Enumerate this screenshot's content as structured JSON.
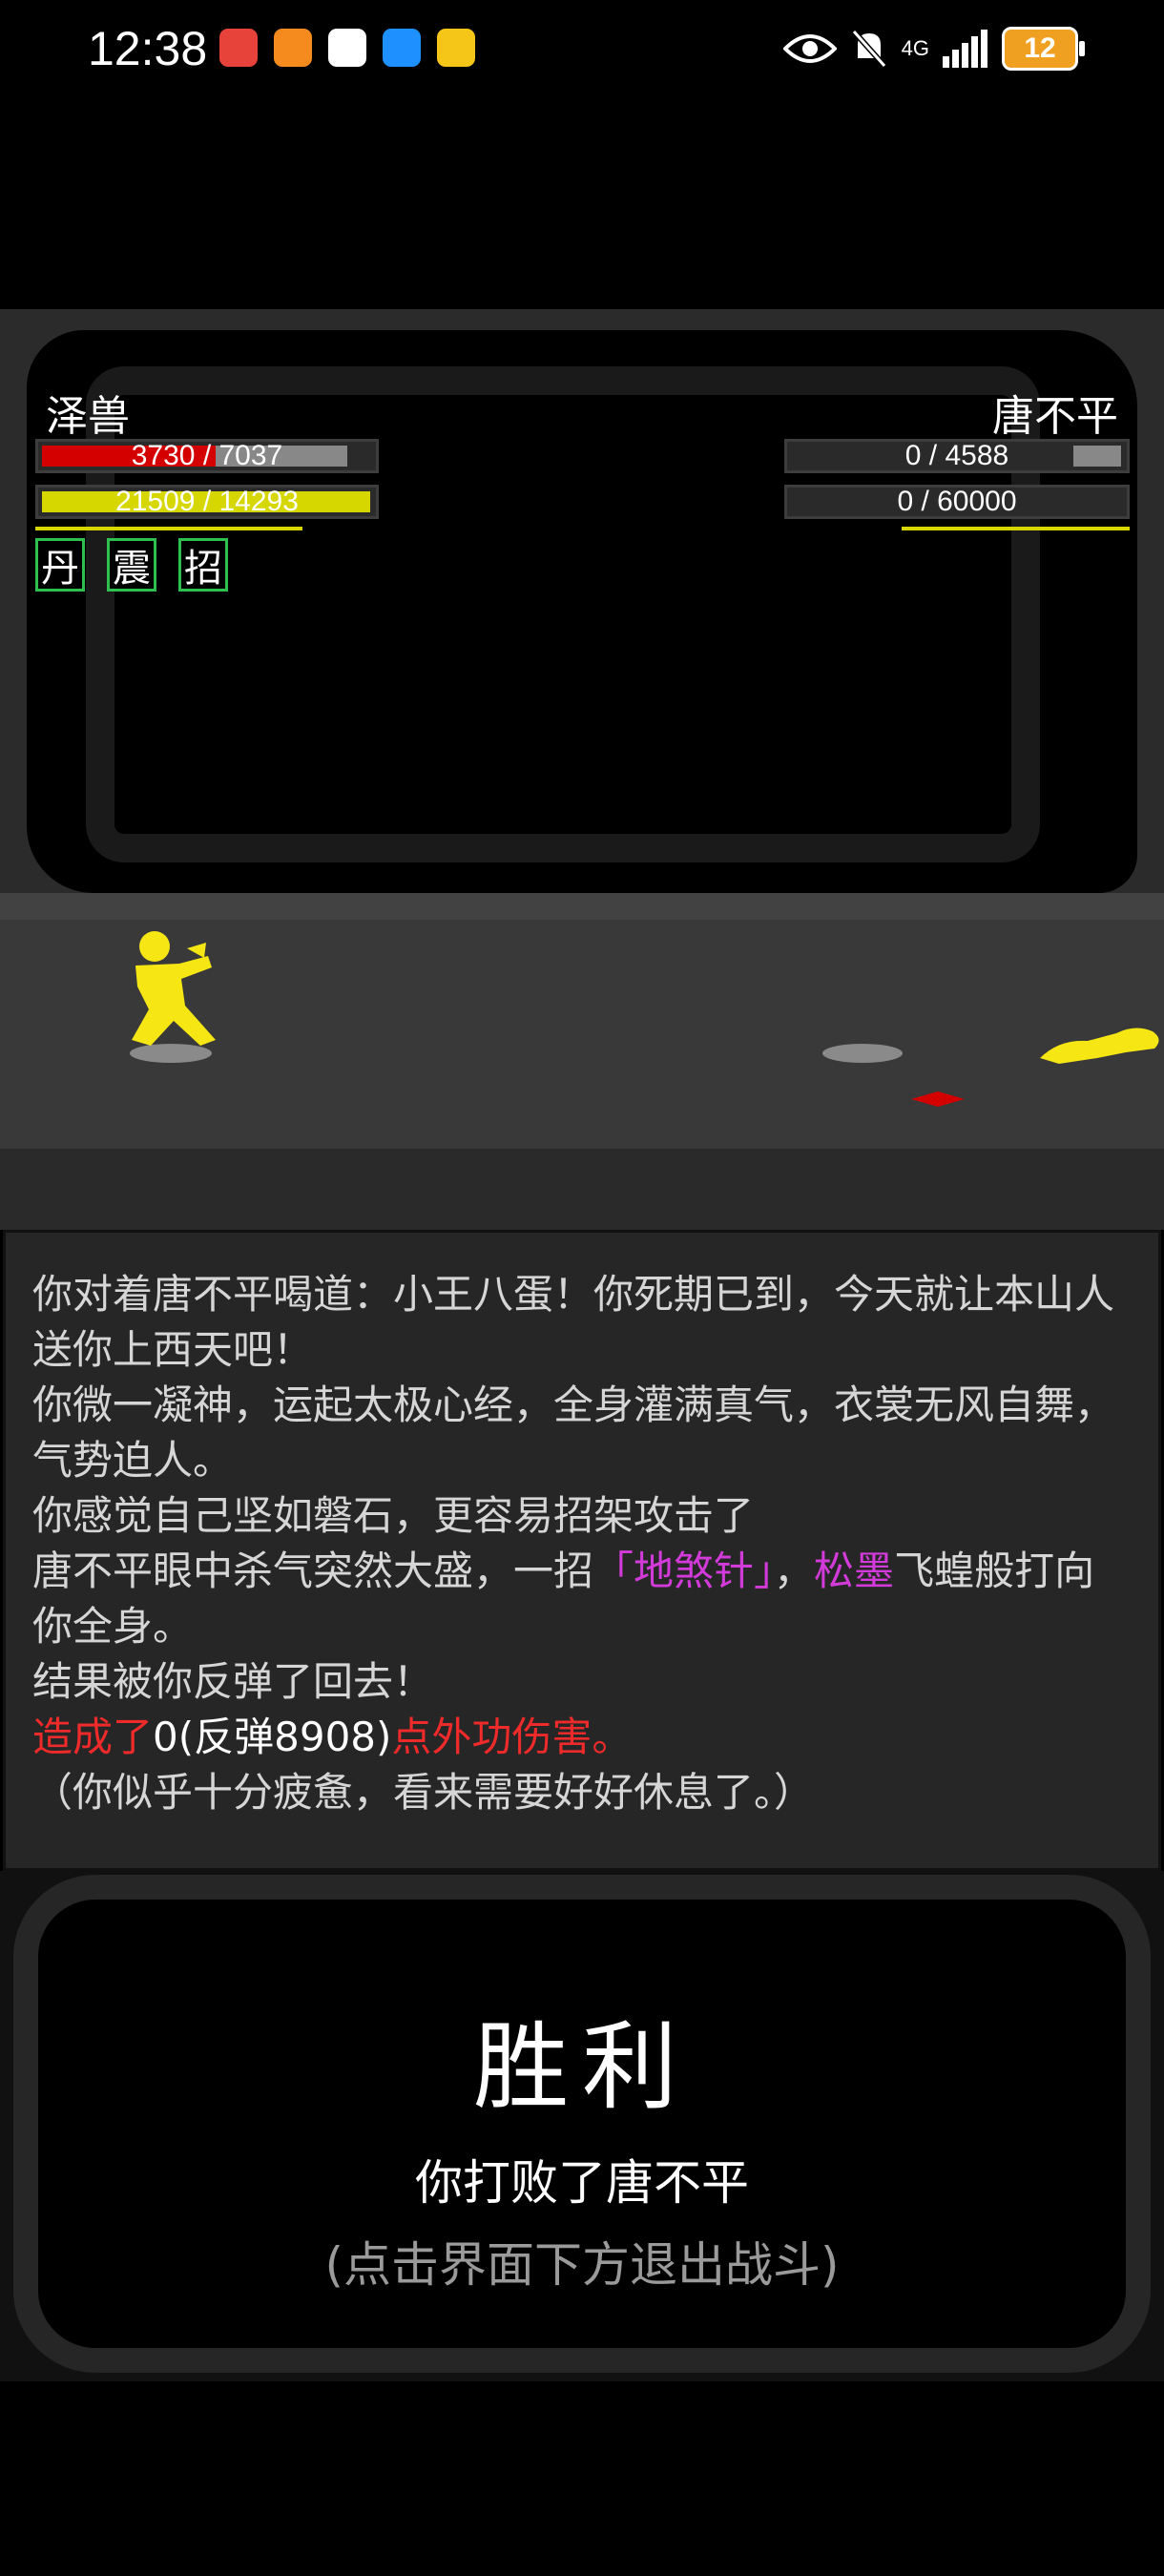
{
  "status_bar": {
    "time": "12:38",
    "network": "4G",
    "battery": "12",
    "notifications": [
      "missed-call-icon",
      "gift-icon",
      "qq-icon",
      "message-icon",
      "mail-icon"
    ],
    "status_icons": [
      "eye-icon",
      "mute-icon",
      "signal-icon"
    ]
  },
  "player": {
    "name": "泽兽",
    "hp_text": "3730 / 7037",
    "hp_fraction": 0.53,
    "hp_max_fraction": 0.93,
    "mp_text": "21509 / 14293",
    "mp_fraction": 1.0,
    "skills": [
      "丹",
      "震",
      "招"
    ]
  },
  "enemy": {
    "name": "唐不平",
    "hp_text": "0 / 4588",
    "hp_fraction": 0,
    "mp_text": "0 / 60000",
    "mp_fraction": 0
  },
  "log": {
    "line1": "你对着唐不平喝道：小王八蛋！你死期已到，今天就让本山人送你上西天吧！",
    "line2": "你微一凝神，运起太极心经，全身灌满真气，衣裳无风自舞，气势迫人。",
    "line3": "你感觉自己坚如磐石，更容易招架攻击了",
    "line4_a": "唐不平眼中杀气突然大盛，一招",
    "line4_skill": "「地煞针」",
    "line4_b": "，",
    "line4_weapon": "松墨",
    "line4_c": "飞蝗般打向你全身。",
    "line5": "结果被你反弹了回去！",
    "line6_a": "造成了",
    "line6_b": "0(反弹8908)",
    "line6_c": "点外功伤害。",
    "line7": "（你似乎十分疲惫，看来需要好好休息了。）"
  },
  "victory": {
    "title": "胜利",
    "subtitle": "你打败了唐不平",
    "hint": "(点击界面下方退出战斗)"
  },
  "colors": {
    "hp": "#d40000",
    "mp": "#d6d600",
    "log_red": "#ee2a2a",
    "log_purple": "#d23bd9",
    "fighter": "#f5e614"
  }
}
